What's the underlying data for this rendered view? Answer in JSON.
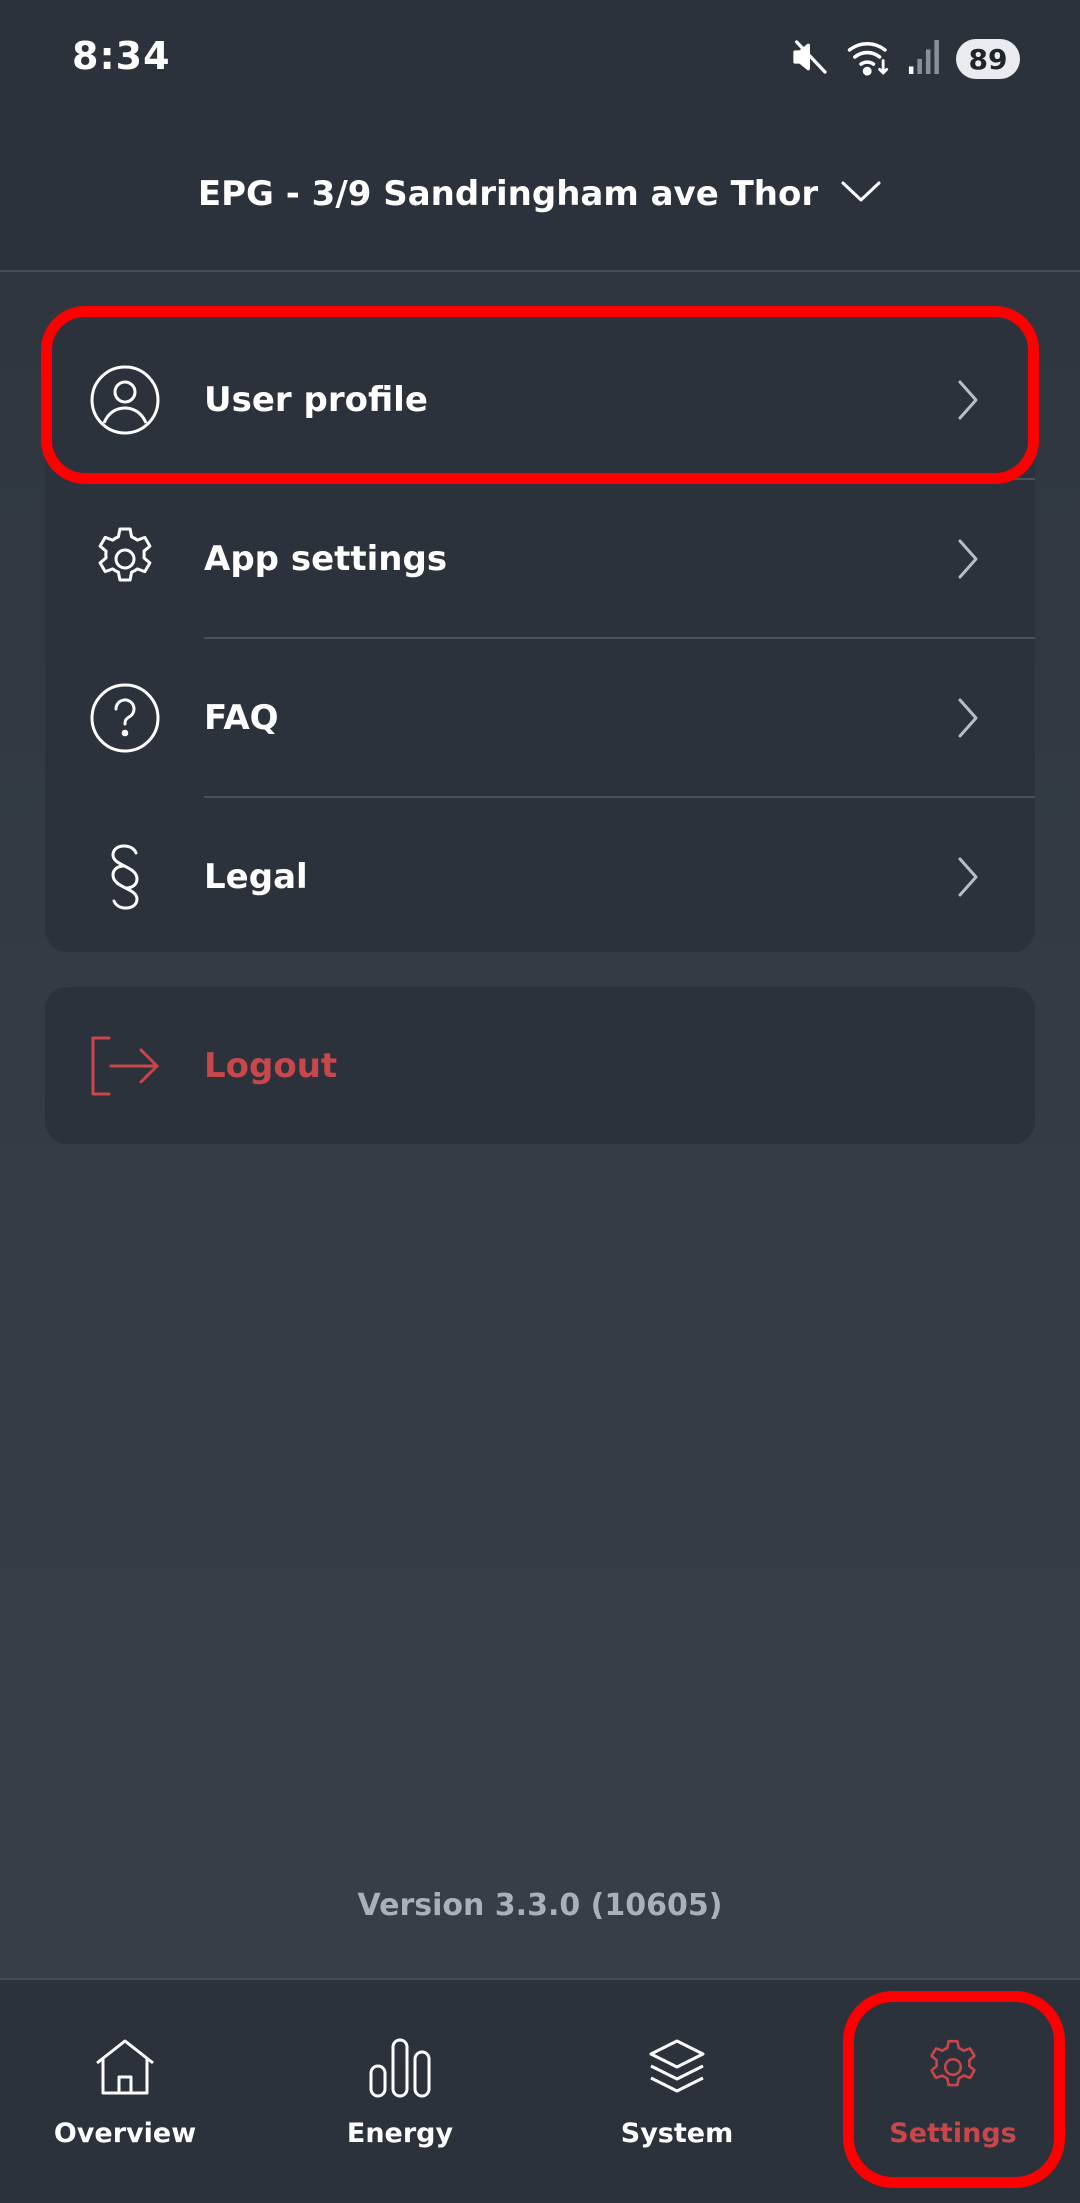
{
  "status_bar": {
    "time": "8:34",
    "battery": "89",
    "icons": [
      "mute-icon",
      "wifi-icon",
      "signal-icon",
      "battery-icon"
    ]
  },
  "header": {
    "site_name": "EPG - 3/9 Sandringham ave Thor"
  },
  "menu": {
    "items": [
      {
        "label": "User profile",
        "icon": "user-icon"
      },
      {
        "label": "App settings",
        "icon": "gear-icon"
      },
      {
        "label": "FAQ",
        "icon": "question-icon"
      },
      {
        "label": "Legal",
        "icon": "section-sign-icon"
      }
    ]
  },
  "logout": {
    "label": "Logout",
    "icon": "logout-icon"
  },
  "version": "Version 3.3.0 (10605)",
  "bottom_nav": {
    "items": [
      {
        "label": "Overview",
        "icon": "home-icon"
      },
      {
        "label": "Energy",
        "icon": "bar-chart-icon"
      },
      {
        "label": "System",
        "icon": "layers-icon"
      },
      {
        "label": "Settings",
        "icon": "gear-icon"
      }
    ],
    "active": "Settings"
  },
  "colors": {
    "background": "#2f3640",
    "card": "#2b323c",
    "accent_red": "#c9474a",
    "highlight": "#ff0000"
  }
}
